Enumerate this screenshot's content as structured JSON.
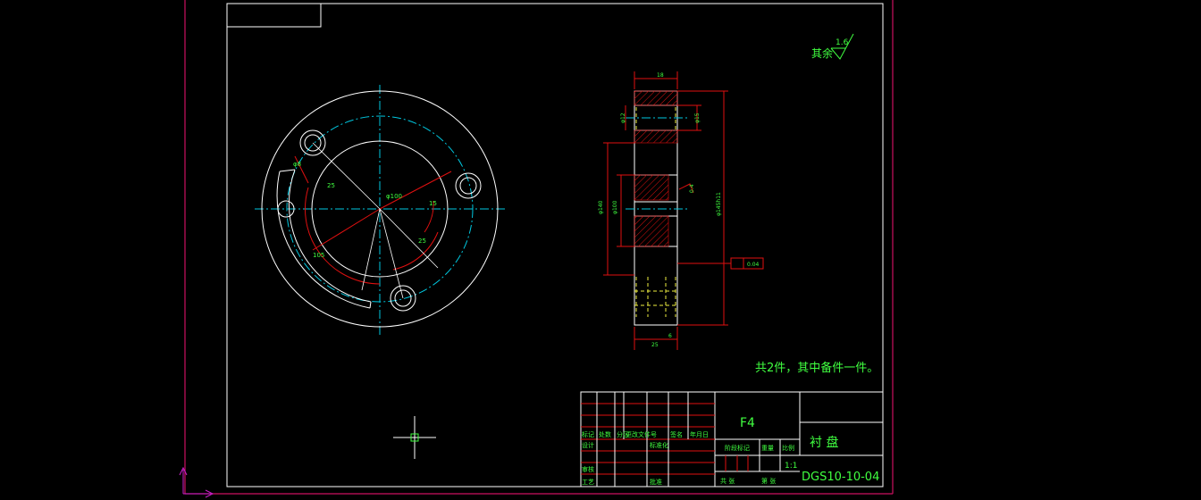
{
  "window": {
    "background": "#000000"
  },
  "colors": {
    "frame": "#cc1060",
    "border": "#ffffff",
    "center": "#00c8e0",
    "dim": "#e01010",
    "text_green": "#40ff40",
    "text_yellow": "#f0f040",
    "hatch": "#e01010"
  },
  "roughness": {
    "label": "其余",
    "value": "1.6"
  },
  "note": "共2件，其中备件一件。",
  "dims_front": {
    "d1": "φ8",
    "d2": "25",
    "d3": "φ100",
    "d4": "15",
    "d5": "25",
    "d6": "105"
  },
  "dims_side": {
    "top": "18",
    "phi12": "φ12",
    "phi15": "φ15",
    "phi140": "φ140",
    "phi100": "φ100",
    "phi145": "φ145h11",
    "roughness": "0.4",
    "bottom1": "25",
    "bottom2": "6",
    "flatness": "0.04"
  },
  "title_block": {
    "material": "F4",
    "part_name": "衬 盘",
    "drawing_no": "DGS10-10-04",
    "scale": "1:1",
    "headers_row1": [
      "标记",
      "处数",
      "分区",
      "更改文件号",
      "签名",
      "年月日"
    ],
    "headers_row2": [
      "设计",
      "",
      "",
      "标准化",
      "",
      ""
    ],
    "col_labels": [
      "阶段标记",
      "重量",
      "比例"
    ],
    "review": "审核",
    "process": "工艺",
    "approve": "批准",
    "sheets": "共  张",
    "sheet": "第  张"
  },
  "ucs": {
    "x": "X",
    "y": "Y"
  }
}
